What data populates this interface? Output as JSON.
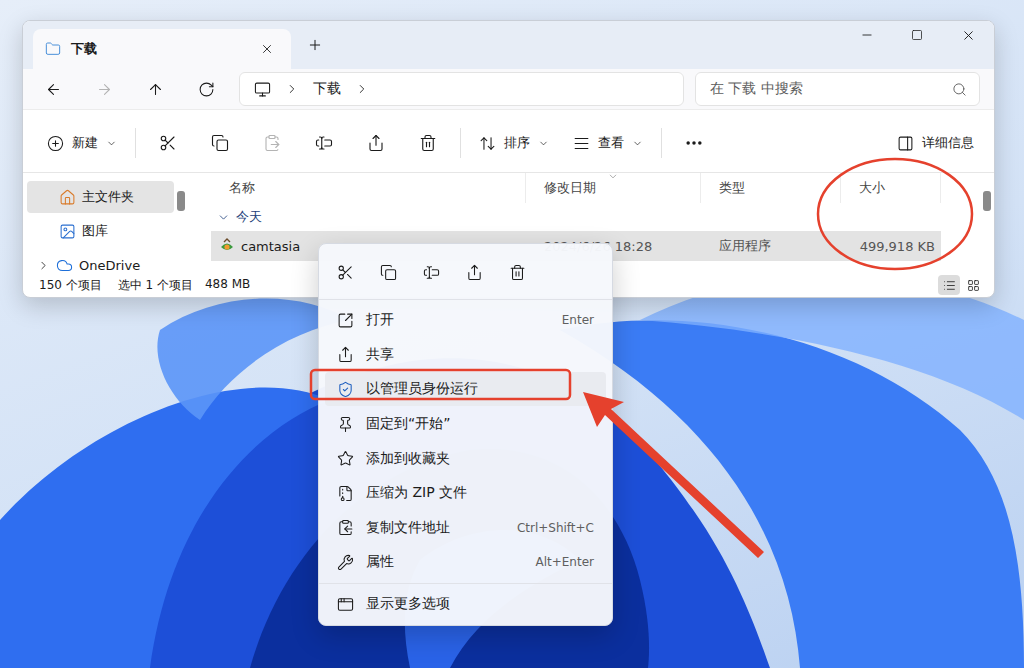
{
  "window": {
    "tab_title": "下载"
  },
  "nav": [
    {
      "kind": "back",
      "disabled": false
    },
    {
      "kind": "forward",
      "disabled": true
    },
    {
      "kind": "up",
      "disabled": false
    },
    {
      "kind": "refresh",
      "disabled": false
    }
  ],
  "address": {
    "crumbs": [
      "下载"
    ]
  },
  "search": {
    "placeholder": "在 下载 中搜索"
  },
  "toolbar": {
    "new": {
      "label": "新建"
    },
    "actions": [
      {
        "kind": "cut",
        "disabled": false
      },
      {
        "kind": "copy",
        "disabled": false
      },
      {
        "kind": "paste",
        "disabled": true
      },
      {
        "kind": "rename",
        "disabled": false
      },
      {
        "kind": "share",
        "disabled": false
      },
      {
        "kind": "delete",
        "disabled": false
      }
    ],
    "sort": {
      "label": "排序"
    },
    "view": {
      "label": "查看"
    },
    "details": {
      "label": "详细信息"
    }
  },
  "sidebar": {
    "items": [
      {
        "label": "主文件夹",
        "kind": "home",
        "selected": true,
        "expandable": false,
        "expanded": false
      },
      {
        "label": "图库",
        "kind": "gallery",
        "selected": false,
        "expandable": false,
        "expanded": false
      },
      {
        "label": "OneDrive",
        "kind": "cloud",
        "selected": false,
        "expandable": true,
        "expanded": false
      }
    ]
  },
  "table": {
    "columns": [
      {
        "label": "名称",
        "sorted": false,
        "annotated": false
      },
      {
        "label": "修改日期",
        "sorted": true,
        "annotated": false
      },
      {
        "label": "类型",
        "sorted": false,
        "annotated": false
      },
      {
        "label": "大小",
        "sorted": false,
        "annotated": true
      }
    ],
    "group": {
      "label": "今天",
      "expanded": true
    },
    "rows": [
      {
        "name": "camtasia",
        "date": "2024/6/26 18:28",
        "type": "应用程序",
        "size": "499,918 KB",
        "selected": true
      }
    ]
  },
  "status_bar": {
    "count": "150 个项目",
    "selection": "选中 1 个项目",
    "selection_size": "488 MB"
  },
  "view_modes": [
    {
      "kind": "details",
      "selected": true
    },
    {
      "kind": "tiles",
      "selected": false
    }
  ],
  "context_menu": {
    "quick_actions": [
      {
        "kind": "cut"
      },
      {
        "kind": "copy"
      },
      {
        "kind": "rename"
      },
      {
        "kind": "share"
      },
      {
        "kind": "delete"
      }
    ],
    "items": [
      {
        "kind": "open",
        "label": "打开",
        "shortcut": "Enter",
        "selected": false,
        "annotated": false
      },
      {
        "kind": "share",
        "label": "共享",
        "shortcut": "",
        "selected": false,
        "annotated": false
      },
      {
        "kind": "admin",
        "label": "以管理员身份运行",
        "shortcut": "",
        "selected": true,
        "annotated": true
      },
      {
        "kind": "pin",
        "label": "固定到“开始”",
        "shortcut": "",
        "selected": false,
        "annotated": false
      },
      {
        "kind": "favorite",
        "label": "添加到收藏夹",
        "shortcut": "",
        "selected": false,
        "annotated": false
      },
      {
        "kind": "zip",
        "label": "压缩为 ZIP 文件",
        "shortcut": "",
        "selected": false,
        "annotated": false
      },
      {
        "kind": "copy-path",
        "label": "复制文件地址",
        "shortcut": "Ctrl+Shift+C",
        "selected": false,
        "annotated": false
      },
      {
        "kind": "properties",
        "label": "属性",
        "shortcut": "Alt+Enter",
        "selected": false,
        "annotated": false
      }
    ],
    "more": {
      "label": "显示更多选项"
    }
  }
}
